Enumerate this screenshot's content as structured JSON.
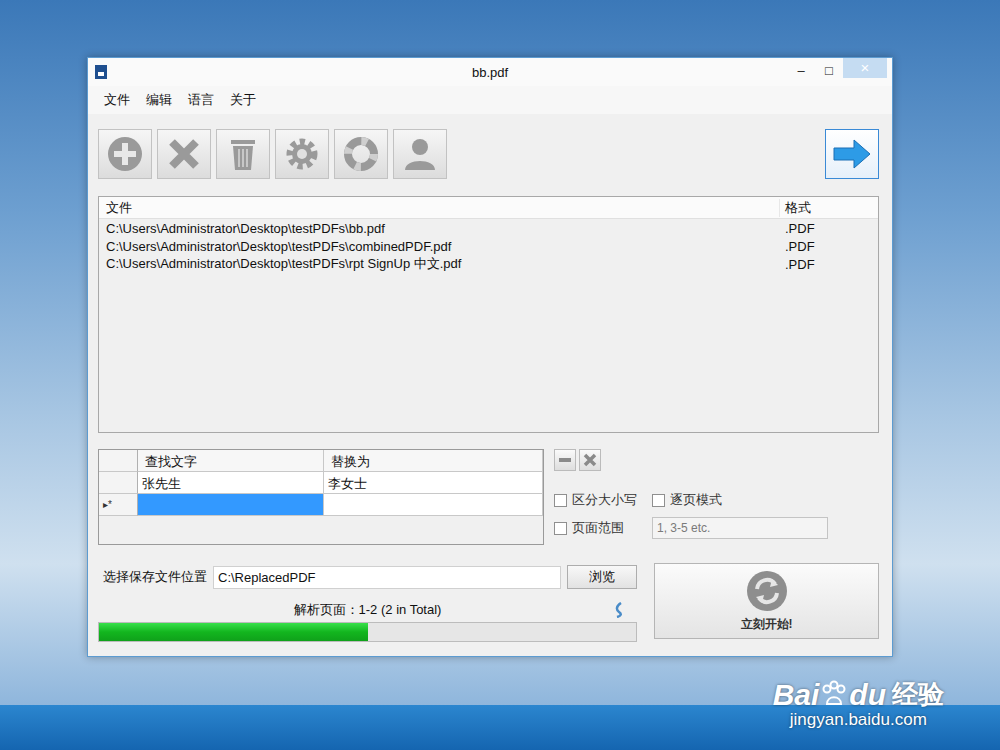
{
  "window": {
    "title": "bb.pdf",
    "controls": [
      "–",
      "□",
      "×"
    ]
  },
  "menu": [
    "文件",
    "编辑",
    "语言",
    "关于"
  ],
  "files": {
    "columns": [
      "文件",
      "格式"
    ],
    "rows": [
      {
        "path": "C:\\Users\\Administrator\\Desktop\\testPDFs\\bb.pdf",
        "format": ".PDF"
      },
      {
        "path": "C:\\Users\\Administrator\\Desktop\\testPDFs\\combinedPDF.pdf",
        "format": ".PDF"
      },
      {
        "path": "C:\\Users\\Administrator\\Desktop\\testPDFs\\rpt SignUp 中文.pdf",
        "format": ".PDF"
      }
    ]
  },
  "replacements": {
    "columns": [
      "查找文字",
      "替换为"
    ],
    "rows": [
      {
        "find": "张先生",
        "replace": "李女士"
      }
    ],
    "new_row": {
      "marker": "▸*",
      "selected": true
    }
  },
  "options": [
    {
      "label": "区分大小写",
      "checked": false
    },
    {
      "label": "逐页模式",
      "checked": false
    },
    {
      "label": "页面范围",
      "checked": false
    }
  ],
  "page_range": {
    "placeholder": "1, 3-5 etc."
  },
  "save": {
    "label": "选择保存文件位置",
    "value": "C:\\ReplacedPDF",
    "browse": "浏览"
  },
  "progress": {
    "text": "解析页面：1-2 (2 in Total)",
    "level": 0.5
  },
  "start_button": {
    "label": "立刻开始!"
  },
  "watermark": {
    "brand": "Bai",
    "brand2": "du",
    "product": "经验",
    "url": "jingyan.baidu.com"
  }
}
